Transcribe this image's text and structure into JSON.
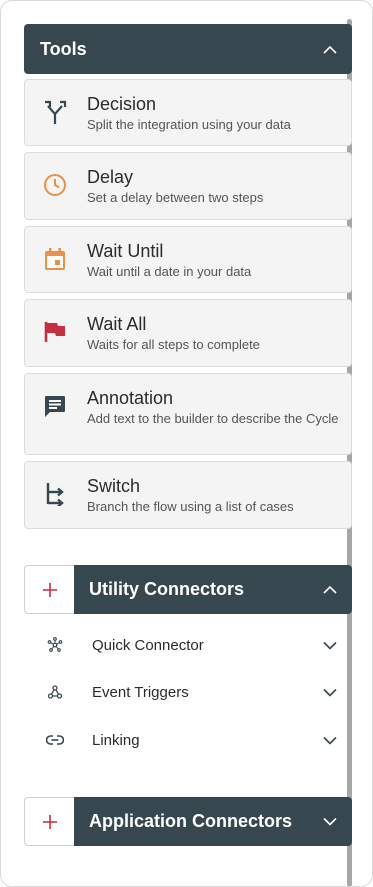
{
  "tools": {
    "title": "Tools",
    "items": [
      {
        "name": "Decision",
        "description": "Split the integration using your data",
        "icon": "split-arrows-icon"
      },
      {
        "name": "Delay",
        "description": "Set a delay between two steps",
        "icon": "clock-icon"
      },
      {
        "name": "Wait Until",
        "description": "Wait until a date in your data",
        "icon": "calendar-icon"
      },
      {
        "name": "Wait All",
        "description": "Waits for all steps to complete",
        "icon": "flag-icon"
      },
      {
        "name": "Annotation",
        "description": "Add text to the builder to describe the Cycle",
        "icon": "comment-icon"
      },
      {
        "name": "Switch",
        "description": "Branch the flow using a list of cases",
        "icon": "branch-arrows-icon"
      }
    ]
  },
  "utility_connectors": {
    "title": "Utility Connectors",
    "items": [
      {
        "label": "Quick Connector",
        "icon": "hub-icon"
      },
      {
        "label": "Event Triggers",
        "icon": "webhook-icon"
      },
      {
        "label": "Linking",
        "icon": "link-icon"
      }
    ]
  },
  "application_connectors": {
    "title": "Application Connectors"
  },
  "colors": {
    "header_bg": "#37474f",
    "clock": "#e8914a",
    "calendar": "#e8914a",
    "flag": "#c62f3f",
    "plus": "#c62f3f",
    "icon_dark": "#37474f"
  }
}
